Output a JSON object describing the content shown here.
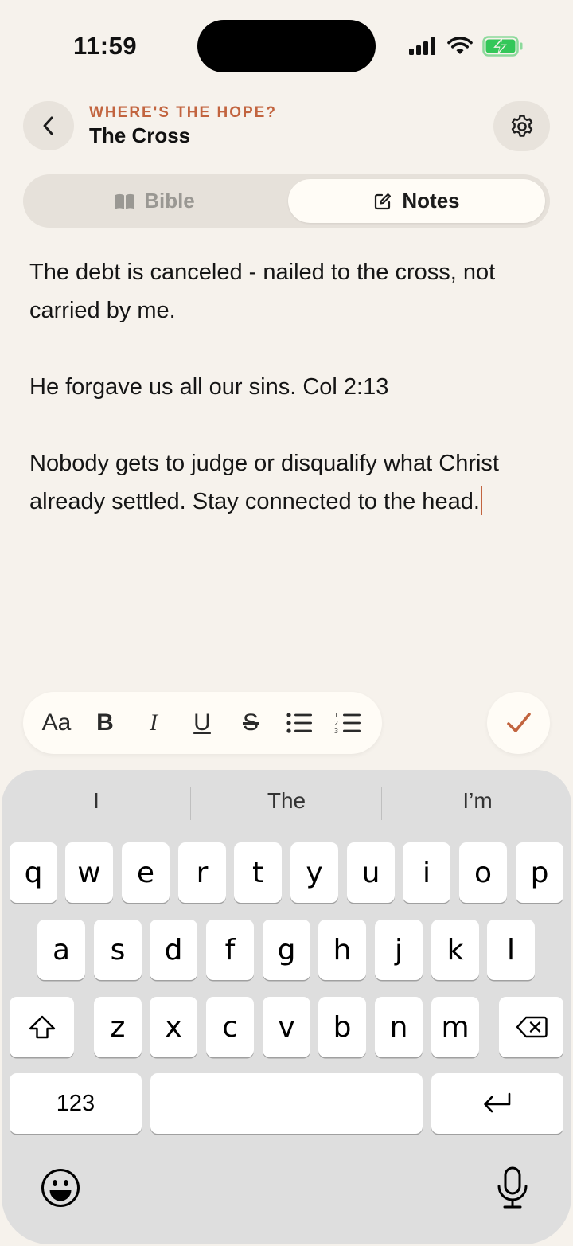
{
  "status_bar": {
    "time": "11:59",
    "icons": [
      "cellular-signal-icon",
      "wifi-icon",
      "battery-charging-icon"
    ],
    "battery_color": "#34C759"
  },
  "header": {
    "kicker": "WHERE'S THE HOPE?",
    "title": "The Cross",
    "back_icon": "chevron-left-icon",
    "settings_icon": "gear-icon",
    "accent_color": "#C2643F"
  },
  "tabs": [
    {
      "label": "Bible",
      "icon": "book-icon",
      "selected": false
    },
    {
      "label": "Notes",
      "icon": "compose-icon",
      "selected": true
    }
  ],
  "note": {
    "paragraphs": [
      "The debt is canceled - nailed to the cross, not carried by me.",
      "He forgave us all our sins. Col 2:13",
      "Nobody gets to judge or disqualify what Christ already settled. Stay connected to the head."
    ]
  },
  "format_toolbar": {
    "buttons": [
      {
        "label": "Aa",
        "name": "text-style"
      },
      {
        "label": "B",
        "name": "bold"
      },
      {
        "label": "I",
        "name": "italic"
      },
      {
        "label": "U",
        "name": "underline"
      },
      {
        "label": "S",
        "name": "strikethrough"
      },
      {
        "label": "",
        "name": "bullet-list"
      },
      {
        "label": "",
        "name": "numbered-list"
      }
    ],
    "done_icon": "checkmark-icon"
  },
  "keyboard": {
    "suggestions": [
      "I",
      "The",
      "I’m"
    ],
    "row1": [
      "q",
      "w",
      "e",
      "r",
      "t",
      "y",
      "u",
      "i",
      "o",
      "p"
    ],
    "row2": [
      "a",
      "s",
      "d",
      "f",
      "g",
      "h",
      "j",
      "k",
      "l"
    ],
    "row3": [
      "z",
      "x",
      "c",
      "v",
      "b",
      "n",
      "m"
    ],
    "numbers_key": "123",
    "space_key": "",
    "emoji_icon": "emoji-icon",
    "mic_icon": "microphone-icon"
  }
}
